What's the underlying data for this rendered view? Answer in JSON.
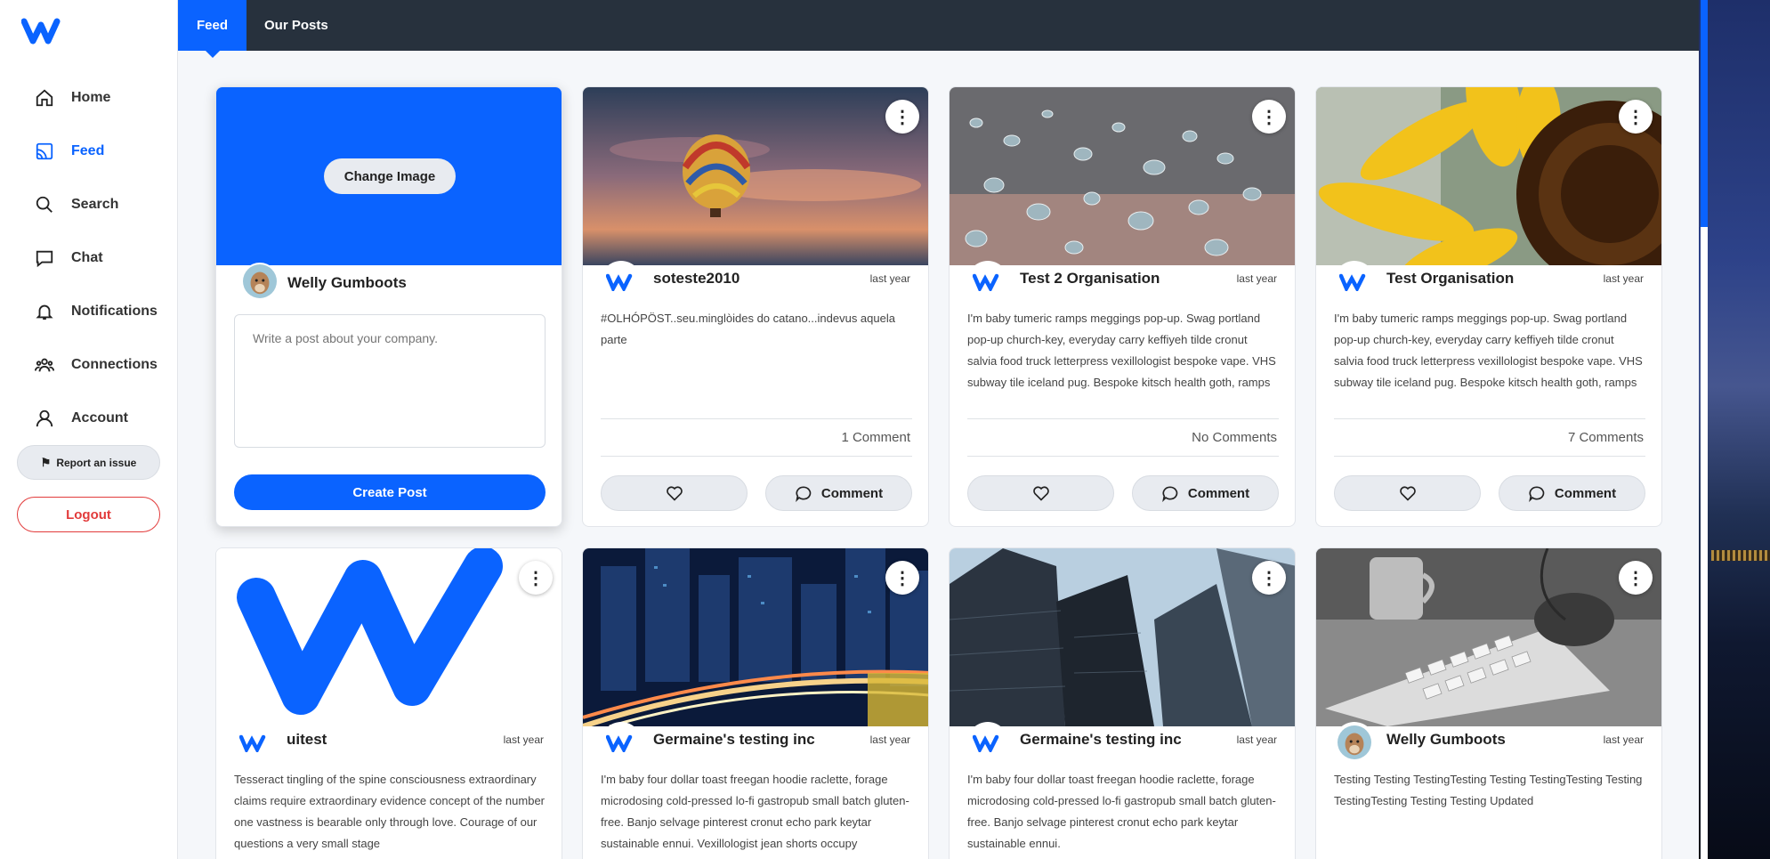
{
  "sidebar": {
    "items": [
      {
        "label": "Home"
      },
      {
        "label": "Feed"
      },
      {
        "label": "Search"
      },
      {
        "label": "Chat"
      },
      {
        "label": "Notifications"
      },
      {
        "label": "Connections"
      },
      {
        "label": "Account"
      }
    ],
    "report_label": "Report an issue",
    "logout_label": "Logout"
  },
  "topbar": {
    "tabs": [
      {
        "label": "Feed"
      },
      {
        "label": "Our Posts"
      }
    ]
  },
  "create": {
    "change_image": "Change Image",
    "user": "Welly Gumboots",
    "placeholder": "Write a post about your company.",
    "button": "Create Post"
  },
  "posts": [
    {
      "org": "soteste2010",
      "time": "last year",
      "text": "#OLHÓPÖST..seu.minglòides do catano...indevus aquela parte",
      "comments": "1 Comment",
      "comment_label": "Comment"
    },
    {
      "org": "Test 2 Organisation",
      "time": "last year",
      "text": "I'm baby tumeric ramps meggings pop-up. Swag portland pop-up church-key, everyday carry keffiyeh tilde cronut salvia food truck letterpress vexillologist bespoke vape. VHS subway tile iceland pug. Bespoke kitsch health goth, ramps tousled man bun selfies hexagon iPhone.",
      "comments": "No Comments",
      "comment_label": "Comment"
    },
    {
      "org": "Test Organisation",
      "time": "last year",
      "text": "I'm baby tumeric ramps meggings pop-up. Swag portland pop-up church-key, everyday carry keffiyeh tilde cronut salvia food truck letterpress vexillologist bespoke vape. VHS subway tile iceland pug. Bespoke kitsch health goth, ramps tousled man bun selfies hexagon iPhone.",
      "comments": "7 Comments",
      "comment_label": "Comment"
    },
    {
      "org": "uitest",
      "time": "last year",
      "text": "Tesseract tingling of the spine consciousness extraordinary claims require extraordinary evidence concept of the number one vastness is bearable only through love. Courage of our questions a very small stage"
    },
    {
      "org": "Germaine's testing inc",
      "time": "last year",
      "text": "I'm baby four dollar toast freegan hoodie raclette, forage microdosing cold-pressed lo-fi gastropub small batch gluten-free. Banjo selvage pinterest cronut echo park keytar sustainable ennui. Vexillologist jean shorts occupy"
    },
    {
      "org": "Germaine's testing inc",
      "time": "last year",
      "text": "I'm baby four dollar toast freegan hoodie raclette, forage microdosing cold-pressed lo-fi gastropub small batch gluten-free. Banjo selvage pinterest cronut echo park keytar sustainable ennui."
    },
    {
      "org": "Welly Gumboots",
      "time": "last year",
      "text": "Testing Testing TestingTesting Testing TestingTesting Testing TestingTesting Testing Testing Updated"
    }
  ],
  "colors": {
    "accent": "#0a63ff",
    "topbar": "#27313d",
    "logout": "#e23b3b"
  }
}
